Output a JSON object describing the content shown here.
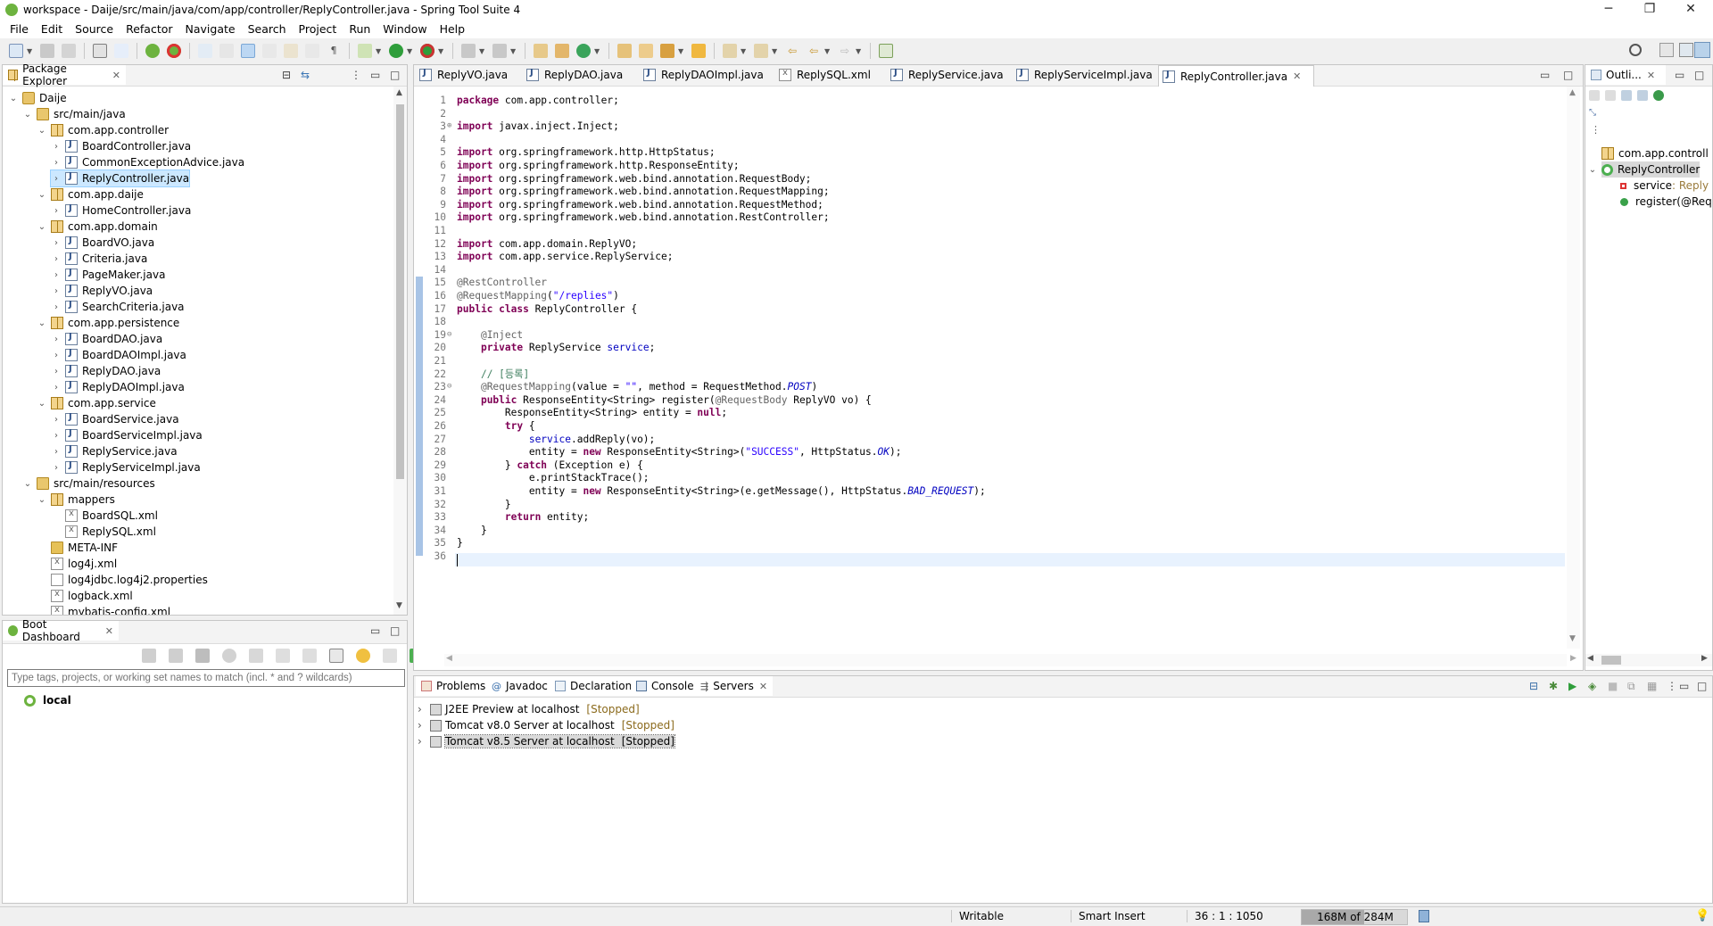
{
  "window": {
    "title": "workspace - Daije/src/main/java/com/app/controller/ReplyController.java - Spring Tool Suite 4",
    "minimize_label": "─",
    "restore_label": "❐",
    "close_label": "✕"
  },
  "menu": [
    "File",
    "Edit",
    "Source",
    "Refactor",
    "Navigate",
    "Search",
    "Project",
    "Run",
    "Window",
    "Help"
  ],
  "package_explorer": {
    "tab_label": "Package Explorer",
    "tree": [
      {
        "depth": 0,
        "twisty": "open",
        "icon": "project",
        "label": "Daije"
      },
      {
        "depth": 1,
        "twisty": "open",
        "icon": "srcfolder",
        "label": "src/main/java"
      },
      {
        "depth": 2,
        "twisty": "open",
        "icon": "package",
        "label": "com.app.controller"
      },
      {
        "depth": 3,
        "twisty": "closed",
        "icon": "java",
        "label": "BoardController.java"
      },
      {
        "depth": 3,
        "twisty": "closed",
        "icon": "java",
        "label": "CommonExceptionAdvice.java"
      },
      {
        "depth": 3,
        "twisty": "closed",
        "icon": "java",
        "label": "ReplyController.java",
        "selected": true
      },
      {
        "depth": 2,
        "twisty": "open",
        "icon": "package",
        "label": "com.app.daije"
      },
      {
        "depth": 3,
        "twisty": "closed",
        "icon": "java",
        "label": "HomeController.java"
      },
      {
        "depth": 2,
        "twisty": "open",
        "icon": "package",
        "label": "com.app.domain"
      },
      {
        "depth": 3,
        "twisty": "closed",
        "icon": "java",
        "label": "BoardVO.java"
      },
      {
        "depth": 3,
        "twisty": "closed",
        "icon": "java",
        "label": "Criteria.java"
      },
      {
        "depth": 3,
        "twisty": "closed",
        "icon": "java",
        "label": "PageMaker.java"
      },
      {
        "depth": 3,
        "twisty": "closed",
        "icon": "java",
        "label": "ReplyVO.java"
      },
      {
        "depth": 3,
        "twisty": "closed",
        "icon": "java",
        "label": "SearchCriteria.java"
      },
      {
        "depth": 2,
        "twisty": "open",
        "icon": "package",
        "label": "com.app.persistence"
      },
      {
        "depth": 3,
        "twisty": "closed",
        "icon": "java",
        "label": "BoardDAO.java"
      },
      {
        "depth": 3,
        "twisty": "closed",
        "icon": "java",
        "label": "BoardDAOImpl.java"
      },
      {
        "depth": 3,
        "twisty": "closed",
        "icon": "java",
        "label": "ReplyDAO.java"
      },
      {
        "depth": 3,
        "twisty": "closed",
        "icon": "java",
        "label": "ReplyDAOImpl.java"
      },
      {
        "depth": 2,
        "twisty": "open",
        "icon": "package",
        "label": "com.app.service"
      },
      {
        "depth": 3,
        "twisty": "closed",
        "icon": "java",
        "label": "BoardService.java"
      },
      {
        "depth": 3,
        "twisty": "closed",
        "icon": "java",
        "label": "BoardServiceImpl.java"
      },
      {
        "depth": 3,
        "twisty": "closed",
        "icon": "java",
        "label": "ReplyService.java"
      },
      {
        "depth": 3,
        "twisty": "closed",
        "icon": "java",
        "label": "ReplyServiceImpl.java"
      },
      {
        "depth": 1,
        "twisty": "open",
        "icon": "srcfolder",
        "label": "src/main/resources"
      },
      {
        "depth": 2,
        "twisty": "open",
        "icon": "package",
        "label": "mappers"
      },
      {
        "depth": 3,
        "twisty": "none",
        "icon": "xml",
        "label": "BoardSQL.xml"
      },
      {
        "depth": 3,
        "twisty": "none",
        "icon": "xml",
        "label": "ReplySQL.xml"
      },
      {
        "depth": 2,
        "twisty": "none",
        "icon": "folder",
        "label": "META-INF"
      },
      {
        "depth": 2,
        "twisty": "none",
        "icon": "xml",
        "label": "log4j.xml"
      },
      {
        "depth": 2,
        "twisty": "none",
        "icon": "file",
        "label": "log4jdbc.log4j2.properties"
      },
      {
        "depth": 2,
        "twisty": "none",
        "icon": "xml",
        "label": "logback.xml"
      },
      {
        "depth": 2,
        "twisty": "none",
        "icon": "xml",
        "label": "mybatis-config.xml"
      }
    ]
  },
  "boot_dashboard": {
    "tab_label": "Boot Dashboard",
    "filter_placeholder": "Type tags, projects, or working set names to match (incl. * and ? wildcards)",
    "items": [
      "local"
    ]
  },
  "editor": {
    "tabs": [
      {
        "label": "ReplyVO.java",
        "icon": "java"
      },
      {
        "label": "ReplyDAO.java",
        "icon": "java"
      },
      {
        "label": "ReplyDAOImpl.java",
        "icon": "java"
      },
      {
        "label": "ReplySQL.xml",
        "icon": "xml"
      },
      {
        "label": "ReplyService.java",
        "icon": "java"
      },
      {
        "label": "ReplyServiceImpl.java",
        "icon": "java"
      },
      {
        "label": "ReplyController.java",
        "icon": "java",
        "active": true
      }
    ],
    "lines": [
      {
        "n": "1",
        "fold": "",
        "html": "<span class=\"kw\">package</span> com.app.controller;"
      },
      {
        "n": "2",
        "fold": "",
        "html": ""
      },
      {
        "n": "3",
        "fold": "⊕",
        "html": "<span class=\"kw\">import</span> javax.inject.Inject;"
      },
      {
        "n": "4",
        "fold": "",
        "html": ""
      },
      {
        "n": "5",
        "fold": "",
        "html": "<span class=\"kw\">import</span> org.springframework.http.HttpStatus;"
      },
      {
        "n": "6",
        "fold": "",
        "html": "<span class=\"kw\">import</span> org.springframework.http.ResponseEntity;"
      },
      {
        "n": "7",
        "fold": "",
        "html": "<span class=\"kw\">import</span> org.springframework.web.bind.annotation.RequestBody;"
      },
      {
        "n": "8",
        "fold": "",
        "html": "<span class=\"kw\">import</span> org.springframework.web.bind.annotation.RequestMapping;"
      },
      {
        "n": "9",
        "fold": "",
        "html": "<span class=\"kw\">import</span> org.springframework.web.bind.annotation.RequestMethod;"
      },
      {
        "n": "10",
        "fold": "",
        "html": "<span class=\"kw\">import</span> org.springframework.web.bind.annotation.RestController;"
      },
      {
        "n": "11",
        "fold": "",
        "html": ""
      },
      {
        "n": "12",
        "fold": "",
        "html": "<span class=\"kw\">import</span> com.app.domain.ReplyVO;"
      },
      {
        "n": "13",
        "fold": "",
        "html": "<span class=\"kw\">import</span> com.app.service.ReplyService;"
      },
      {
        "n": "14",
        "fold": "",
        "html": ""
      },
      {
        "n": "15",
        "fold": "",
        "html": "<span class=\"an\">@RestController</span>"
      },
      {
        "n": "16",
        "fold": "",
        "html": "<span class=\"an\">@RequestMapping</span>(<span class=\"st\">\"/replies\"</span>)"
      },
      {
        "n": "17",
        "fold": "",
        "html": "<span class=\"kw\">public class</span> ReplyController {"
      },
      {
        "n": "18",
        "fold": "",
        "html": ""
      },
      {
        "n": "19",
        "fold": "⊖",
        "html": "    <span class=\"an\">@Inject</span>"
      },
      {
        "n": "20",
        "fold": "",
        "html": "    <span class=\"kw\">private</span> ReplyService <span class=\"fd\">service</span>;"
      },
      {
        "n": "21",
        "fold": "",
        "html": ""
      },
      {
        "n": "22",
        "fold": "",
        "html": "    <span class=\"cm\">// [등록]</span>"
      },
      {
        "n": "23",
        "fold": "⊖",
        "html": "    <span class=\"an\">@RequestMapping</span>(value = <span class=\"st\">\"\"</span>, method = RequestMethod.<span class=\"it\">POST</span>)"
      },
      {
        "n": "24",
        "fold": "",
        "html": "    <span class=\"kw\">public</span> ResponseEntity&lt;String&gt; register(<span class=\"an\">@RequestBody</span> ReplyVO vo) {"
      },
      {
        "n": "25",
        "fold": "",
        "html": "        ResponseEntity&lt;String&gt; entity = <span class=\"kw\">null</span>;"
      },
      {
        "n": "26",
        "fold": "",
        "html": "        <span class=\"kw\">try</span> {"
      },
      {
        "n": "27",
        "fold": "",
        "html": "            <span class=\"fd\">service</span>.addReply(vo);"
      },
      {
        "n": "28",
        "fold": "",
        "html": "            entity = <span class=\"kw\">new</span> ResponseEntity&lt;String&gt;(<span class=\"st\">\"SUCCESS\"</span>, HttpStatus.<span class=\"it\">OK</span>);"
      },
      {
        "n": "29",
        "fold": "",
        "html": "        } <span class=\"kw\">catch</span> (Exception e) {"
      },
      {
        "n": "30",
        "fold": "",
        "html": "            e.printStackTrace();"
      },
      {
        "n": "31",
        "fold": "",
        "html": "            entity = <span class=\"kw\">new</span> ResponseEntity&lt;String&gt;(e.getMessage(), HttpStatus.<span class=\"it\">BAD_REQUEST</span>);"
      },
      {
        "n": "32",
        "fold": "",
        "html": "        }"
      },
      {
        "n": "33",
        "fold": "",
        "html": "        <span class=\"kw\">return</span> entity;"
      },
      {
        "n": "34",
        "fold": "",
        "html": "    }"
      },
      {
        "n": "35",
        "fold": "",
        "html": "}"
      },
      {
        "n": "36",
        "fold": "",
        "html": ""
      }
    ],
    "current_line": "36"
  },
  "outline": {
    "tab_label": "Outli...",
    "items": [
      {
        "label": "com.app.controll",
        "icon": "package",
        "indent": 0
      },
      {
        "label": "ReplyController",
        "icon": "class",
        "indent": 0,
        "selected": true
      },
      {
        "label": "service",
        "suffix": " : Reply",
        "icon": "field",
        "indent": 1
      },
      {
        "label": "register(@Req",
        "icon": "method",
        "indent": 1
      }
    ]
  },
  "bottom_panel": {
    "tabs": [
      {
        "label": "Problems",
        "icon": "problems"
      },
      {
        "label": "Javadoc",
        "icon": "at"
      },
      {
        "label": "Declaration",
        "icon": "declaration"
      },
      {
        "label": "Console",
        "icon": "console"
      },
      {
        "label": "Servers",
        "icon": "servers",
        "active": true
      }
    ],
    "servers": [
      {
        "name": "J2EE Preview at localhost",
        "state": "[Stopped]"
      },
      {
        "name": "Tomcat v8.0 Server at localhost",
        "state": "[Stopped]"
      },
      {
        "name": "Tomcat v8.5 Server at localhost",
        "state": "[Stopped]",
        "selected": true
      }
    ]
  },
  "status": {
    "writable": "Writable",
    "insert_mode": "Smart Insert",
    "position": "36 : 1 : 1050",
    "heap": "168M of 284M",
    "heap_used": 168,
    "heap_total": 284
  },
  "colors": {
    "selection": "#cce8ff",
    "current_line": "#e8f2fe",
    "keyword": "#7f0055",
    "annotation": "#646464",
    "string": "#2a00ff",
    "field": "#0000c0",
    "comment": "#3f7f5f",
    "spring_green": "#6db33f"
  }
}
